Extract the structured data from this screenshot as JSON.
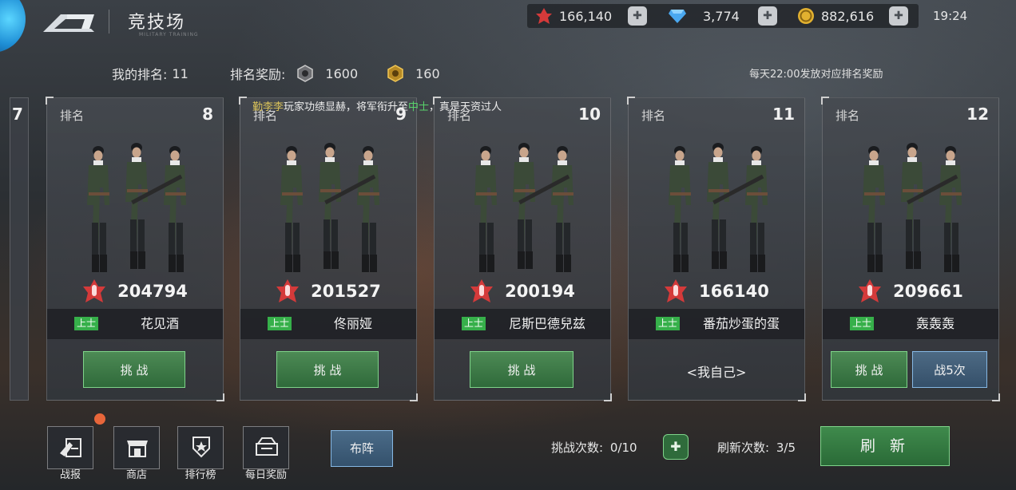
{
  "header": {
    "title": "竞技场",
    "subtitle": "MILITARY TRAINING",
    "resources": [
      {
        "icon": "medal-icon",
        "value": "166,140",
        "color": "#d43a3a"
      },
      {
        "icon": "diamond-icon",
        "value": "3,774",
        "color": "#4aa8f0"
      },
      {
        "icon": "gold-coin-icon",
        "value": "882,616",
        "color": "#e2b130"
      }
    ],
    "clock": "19:24"
  },
  "rank_info": {
    "my_rank_label": "我的排名:",
    "my_rank_value": "11",
    "reward_label": "排名奖励:",
    "reward_1": "1600",
    "reward_2": "160",
    "notice": "每天22:00发放对应排名奖励"
  },
  "marquee": {
    "user": "勤李李",
    "text_1": "玩家功绩显赫，将军衔升至",
    "rank": "中士",
    "text_2": "，真是天资过人"
  },
  "partial_card": {
    "rank": "7"
  },
  "cards": [
    {
      "rank_label": "排名",
      "rank": "8",
      "power": "204794",
      "tag": "上士",
      "name": "花见酒",
      "action": "挑 战"
    },
    {
      "rank_label": "排名",
      "rank": "9",
      "power": "201527",
      "tag": "上士",
      "name": "佟丽娅",
      "action": "挑 战"
    },
    {
      "rank_label": "排名",
      "rank": "10",
      "power": "200194",
      "tag": "上士",
      "name": "尼斯巴德兒兹",
      "action": "挑 战"
    },
    {
      "rank_label": "排名",
      "rank": "11",
      "power": "166140",
      "tag": "上士",
      "name": "番茄炒蛋的蛋",
      "action": "<我自己>"
    },
    {
      "rank_label": "排名",
      "rank": "12",
      "power": "209661",
      "tag": "上士",
      "name": "轰轰轰",
      "action": "挑 战",
      "action_2": "战5次"
    }
  ],
  "bottom": {
    "buttons": [
      {
        "label": "战报",
        "icon": "battle-report-icon"
      },
      {
        "label": "商店",
        "icon": "shop-icon"
      },
      {
        "label": "排行榜",
        "icon": "leaderboard-icon"
      },
      {
        "label": "每日奖励",
        "icon": "daily-reward-icon"
      }
    ],
    "formation": "布阵",
    "challenge_label": "挑战次数:",
    "challenge_value": "0/10",
    "refresh_count_label": "刷新次数:",
    "refresh_count_value": "3/5",
    "refresh": "刷 新"
  }
}
